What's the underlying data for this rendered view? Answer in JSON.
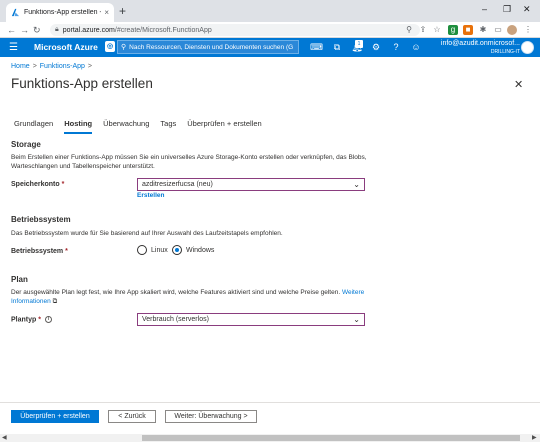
{
  "browser": {
    "tab_title": "Funktions-App erstellen - Micros",
    "tab_close": "×",
    "new_tab": "+",
    "url_domain": "portal.azure.com",
    "url_path": "/#create/Microsoft.FunctionApp",
    "window_controls": [
      "–",
      "❐",
      "✕"
    ]
  },
  "azure": {
    "brand": "Microsoft Azure",
    "search_placeholder": "Nach Ressourcen, Diensten und Dokumenten suchen (G",
    "notification_count": "1",
    "account_email": "info@azudit.onmicrosof...",
    "account_org": "DRILLING-IT"
  },
  "breadcrumb": {
    "home": "Home",
    "sep": ">",
    "current": "Funktions-App",
    "sep2": ">"
  },
  "page": {
    "title": "Funktions-App erstellen",
    "close": "✕"
  },
  "tabs": [
    {
      "label": "Grundlagen",
      "active": false
    },
    {
      "label": "Hosting",
      "active": true
    },
    {
      "label": "Überwachung",
      "active": false
    },
    {
      "label": "Tags",
      "active": false
    },
    {
      "label": "Überprüfen + erstellen",
      "active": false
    }
  ],
  "storage": {
    "heading": "Storage",
    "description": "Beim Erstellen einer Funktions-App müssen Sie ein universelles Azure Storage-Konto erstellen oder verknüpfen, das Blobs, Warteschlangen und Tabellenspeicher unterstützt.",
    "account_label": "Speicherkonto",
    "required_mark": "*",
    "account_value": "azditresizerfucsa (neu)",
    "create_link": "Erstellen"
  },
  "os": {
    "heading": "Betriebssystem",
    "description": "Das Betriebssystem wurde für Sie basierend auf Ihrer Auswahl des Laufzeitstapels empfohlen.",
    "label": "Betriebssystem",
    "required_mark": "*",
    "options": [
      {
        "label": "Linux",
        "selected": false
      },
      {
        "label": "Windows",
        "selected": true
      }
    ]
  },
  "plan": {
    "heading": "Plan",
    "description": "Der ausgewählte Plan legt fest, wie Ihre App skaliert wird, welche Features aktiviert sind und welche Preise gelten.",
    "more_info_link": "Weitere Informationen",
    "label": "Plantyp",
    "required_mark": "*",
    "info": "i",
    "value": "Verbrauch (serverlos)"
  },
  "footer": {
    "review_button": "Überprüfen + erstellen",
    "back_button": "< Zurück",
    "next_button": "Weiter: Überwachung >"
  },
  "colors": {
    "azure_blue": "#0078d4",
    "required_red": "#a4262c",
    "select_border": "#8a3d7e"
  }
}
